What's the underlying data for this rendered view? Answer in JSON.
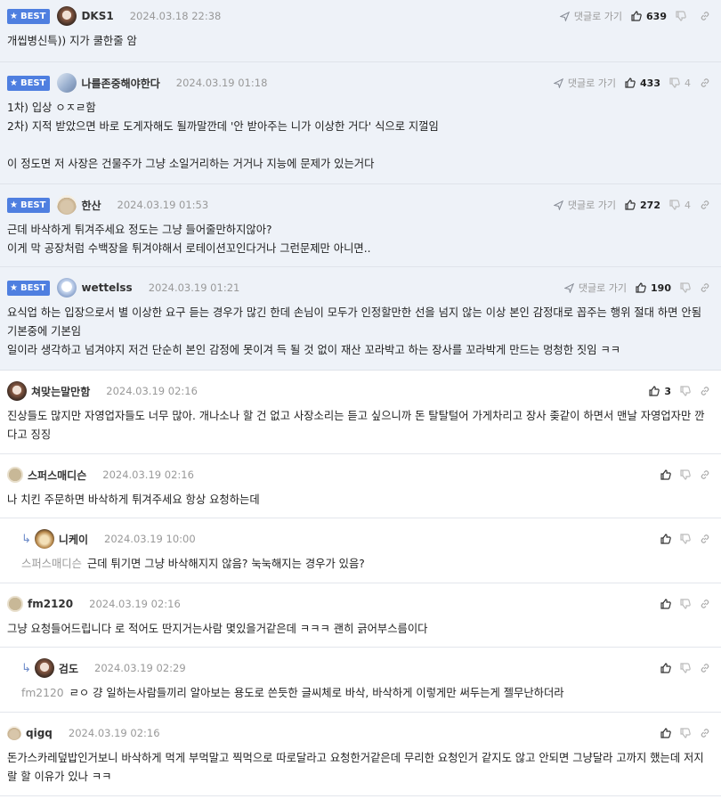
{
  "best_label": "BEST",
  "reply_link_label": "댓글로 가기",
  "comments": [
    {
      "nick": "DKS1",
      "date": "2024.03.18 22:38",
      "up": "639",
      "down": "",
      "avatar": "av-a",
      "lines": [
        "개씹병신특)) 지가 쿨한줄 암"
      ]
    },
    {
      "nick": "나를존중해야한다",
      "date": "2024.03.19 01:18",
      "up": "433",
      "down": "4",
      "avatar": "av-b",
      "lines": [
        "1차) 입상 ㅇㅈㄹ함",
        "2차) 지적 받았으면 바로 도게자해도 될까말깐데 '안 받아주는 니가 이상한 거다' 식으로 지껄임",
        "",
        "이 정도면 저 사장은 건물주가 그냥 소일거리하는 거거나 지능에 문제가 있는거다"
      ]
    },
    {
      "nick": "한산",
      "date": "2024.03.19 01:53",
      "up": "272",
      "down": "4",
      "avatar": "av-c",
      "lines": [
        "근데 바삭하게 튀겨주세요 정도는 그냥 들어줄만하지않아?",
        "이게 막 공장처럼 수백장을 튀겨야해서 로테이션꼬인다거나 그런문제만 아니면.."
      ]
    },
    {
      "nick": "wettelss",
      "date": "2024.03.19 01:21",
      "up": "190",
      "down": "",
      "avatar": "av-d",
      "lines": [
        "요식업 하는 입장으로서 별 이상한 요구 듣는 경우가 많긴 한데 손님이 모두가 인정할만한 선을 넘지 않는 이상 본인 감정대로 꼽주는 행위 절대 하면 안됨 기본중에 기본임",
        "일이라 생각하고 넘겨야지 저건 단순히 본인 감정에 못이겨 득 될 것 없이 재산 꼬라박고 하는 장사를 꼬라박게 만드는 멍청한 짓임 ㅋㅋ"
      ]
    },
    {
      "nick": "쳐맞는말만함",
      "date": "2024.03.19 02:16",
      "up": "3",
      "avatar": "av-a",
      "lines": [
        "진상들도 많지만 자영업자들도 너무 많아. 개나소나 할 건 없고 사장소리는 듣고 싶으니까 돈 탈탈털어 가게차리고 장사 좆같이 하면서 맨날 자영업자만 깐다고 징징"
      ]
    },
    {
      "nick": "스퍼스매디슨",
      "date": "2024.03.19 02:16",
      "up": "",
      "avatar": "av-f",
      "lines": [
        "나 치킨 주문하면 바삭하게 튀겨주세요 항상 요청하는데"
      ]
    },
    {
      "nick": "니케이",
      "date": "2024.03.19 10:00",
      "up": "",
      "avatar": "av-e",
      "mention": "스퍼스매디슨",
      "lines": [
        "근데 튀기면 그냥 바삭해지지 않음? 눅눅해지는 경우가 있음?"
      ]
    },
    {
      "nick": "fm2120",
      "date": "2024.03.19 02:16",
      "up": "",
      "avatar": "av-f",
      "lines": [
        "그냥 요청들어드립니다 로 적어도 딴지거는사람 몇있을거같은데 ㅋㅋㅋ 괜히 긁어부스름이다"
      ]
    },
    {
      "nick": "검도",
      "date": "2024.03.19 02:29",
      "up": "",
      "avatar": "av-a",
      "mention": "fm2120",
      "lines": [
        "ㄹㅇ 걍 일하는사람들끼리 알아보는 용도로 쓴듯한 글씨체로 바삭, 바삭하게 이렇게만 써두는게 젤무난하더라"
      ]
    },
    {
      "nick": "qigq",
      "date": "2024.03.19 02:16",
      "up": "",
      "avatar": "av-c",
      "lines": [
        "돈가스카레덮밥인거보니 바삭하게 먹게 부먹말고 찍먹으로 따로달라고 요청한거같은데 무리한 요청인거 같지도 않고 안되면 그냥달라 고까지 했는데 저지랄 할 이유가 있나 ㅋㅋ"
      ]
    }
  ]
}
